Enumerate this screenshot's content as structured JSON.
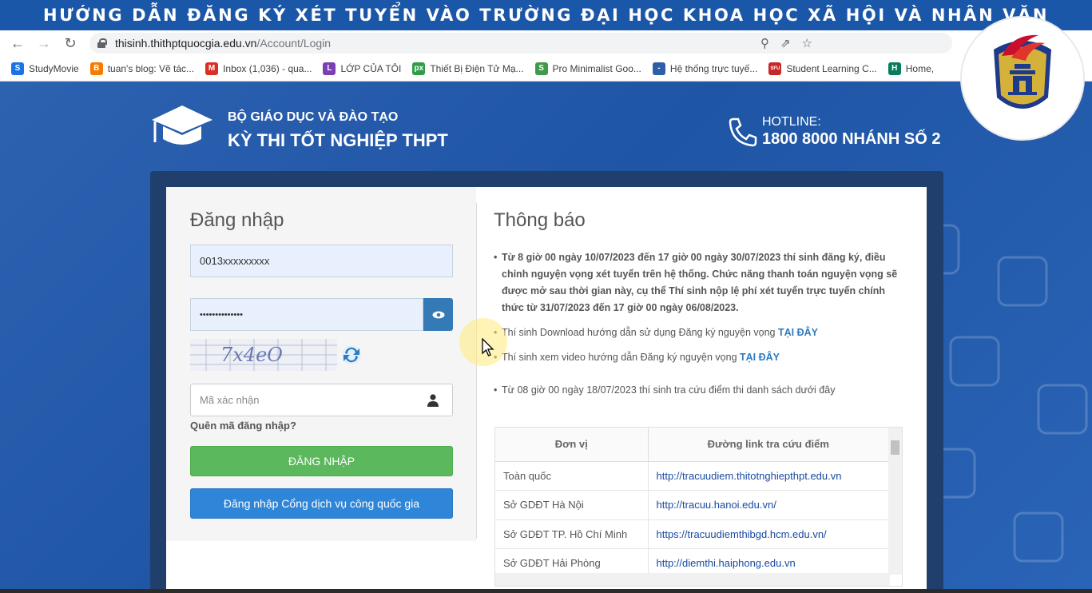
{
  "banner": {
    "title": "HƯỚNG DẪN ĐĂNG KÝ XÉT TUYỂN VÀO TRƯỜNG ĐẠI HỌC KHOA HỌC XÃ HỘI VÀ NHÂN VĂN"
  },
  "browser": {
    "url_host": "thisinh.thithptquocgia.edu.vn",
    "url_path": "/Account/Login",
    "bookmarks": [
      {
        "label": "StudyMovie",
        "icon": "S",
        "color": "#1a73e8"
      },
      {
        "label": "tuan's blog: Vẽ tác...",
        "icon": "B",
        "color": "#f57c00"
      },
      {
        "label": "Inbox (1,036) - qua...",
        "icon": "M",
        "color": "#d93025"
      },
      {
        "label": "LỚP CỦA TÔI",
        "icon": "L",
        "color": "#7b3fb5"
      },
      {
        "label": "Thiết Bị Điện Tử Mạ...",
        "icon": "px",
        "color": "#2e9c4a"
      },
      {
        "label": "Pro Minimalist Goo...",
        "icon": "S",
        "color": "#3f9a4b"
      },
      {
        "label": "Hệ thống trực tuyế...",
        "icon": "-",
        "color": "#2c5fa8"
      },
      {
        "label": "Student Learning C...",
        "icon": "SFU",
        "color": "#c62828"
      },
      {
        "label": "Home,",
        "icon": "H",
        "color": "#0b7b5e"
      }
    ]
  },
  "header": {
    "ministry": "BỘ GIÁO DỤC VÀ ĐÀO TẠO",
    "exam": "KỲ THI TỐT NGHIỆP THPT",
    "hotline_label": "HOTLINE:",
    "hotline_number": "1800 8000 NHÁNH SỐ 2"
  },
  "login": {
    "title": "Đăng nhập",
    "username": "0013xxxxxxxxx",
    "password_mask": "••••••••••••••",
    "captcha_text": "7x4eO",
    "code_placeholder": "Mã xác nhận",
    "forgot": "Quên mã đăng nhập?",
    "login_button": "ĐĂNG NHẬP",
    "portal_button": "Đăng nhập Cổng dịch vụ công quốc gia"
  },
  "notice": {
    "title": "Thông báo",
    "item1": "Từ 8 giờ 00 ngày 10/07/2023 đến 17 giờ 00 ngày 30/07/2023 thí sinh đăng ký, điều chỉnh nguyện vọng xét tuyển trên hệ thống. Chức năng thanh toán nguyện vọng sẽ được mở sau thời gian này, cụ thể Thí sinh nộp lệ phí xét tuyển trực tuyến chính thức từ 31/07/2023 đến 17 giờ 00 ngày 06/08/2023.",
    "item2_text": "Thí sinh Download hướng dẫn sử dụng Đăng ký nguyện vọng ",
    "item2_link": "TẠI ĐÂY",
    "item3_text": "Thí sinh xem video hướng dẫn Đăng ký nguyện vọng ",
    "item3_link": "TẠI ĐÂY",
    "item4": "Từ 08 giờ 00 ngày 18/07/2023 thí sinh tra cứu điểm thi danh sách dưới đây"
  },
  "table": {
    "headers": [
      "Đơn vị",
      "Đường link tra cứu điểm"
    ],
    "rows": [
      [
        "Toàn quốc",
        "http://tracuudiem.thitotnghiepthpt.edu.vn"
      ],
      [
        "Sở GDĐT Hà Nội",
        "http://tracuu.hanoi.edu.vn/"
      ],
      [
        "Sở GDĐT TP. Hồ Chí Minh",
        "https://tracuudiemthibgd.hcm.edu.vn/"
      ],
      [
        "Sở GDĐT Hải Phòng",
        "http://diemthi.haiphong.edu.vn"
      ]
    ]
  },
  "colors": {
    "banner": "#1b57a8",
    "page_bg": "#2a64b6",
    "btn_login": "#5cb85c",
    "btn_portal": "#2f86d8",
    "logo_red": "#c8102e",
    "logo_navy": "#1e3a8a"
  }
}
